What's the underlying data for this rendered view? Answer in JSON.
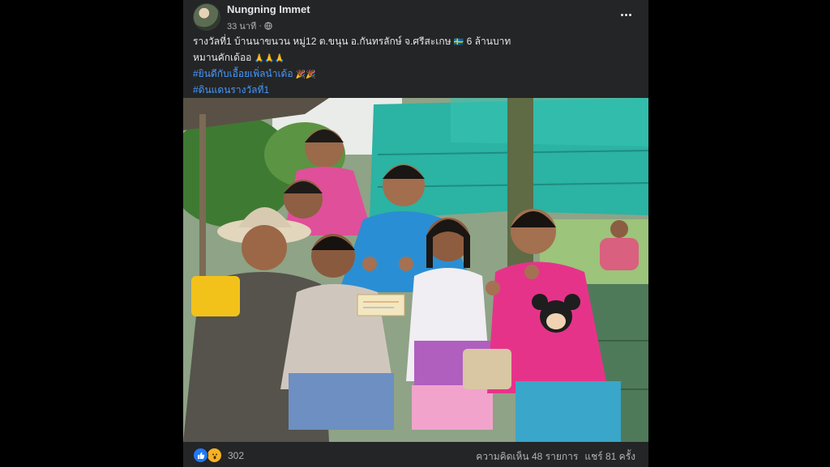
{
  "post": {
    "author": "Nungning Immet",
    "timestamp": "33 นาที",
    "privacy_icon": "globe-icon",
    "lines": [
      "รางวัลที่1 บ้านนาขนวน หมู่12 ต.ขนุน อ.กันทรลักษ์ จ.ศรีสะเกษ",
      "6 ล้านบาท",
      "หมานคักเด้ออ"
    ],
    "hashtags": [
      "#ยินดีกับเอื้อยเพิ่ลนำเด้อ",
      "#ดินแดนรางวัลที่1"
    ],
    "emojis": {
      "line1_after": "🇸🇪",
      "line2_after": "🙏🙏🙏",
      "hash1_after": "🎉🎉"
    }
  },
  "footer": {
    "reaction_count": "302",
    "comments": "ความคิดเห็น 48 รายการ",
    "shares": "แชร์ 81 ครั้ง"
  },
  "colors": {
    "card": "#242526",
    "text": "#e4e6eb",
    "secondary": "#b0b3b8",
    "hashtag": "#4599ff",
    "like": "#2078f4",
    "wow": "#f7b125"
  }
}
